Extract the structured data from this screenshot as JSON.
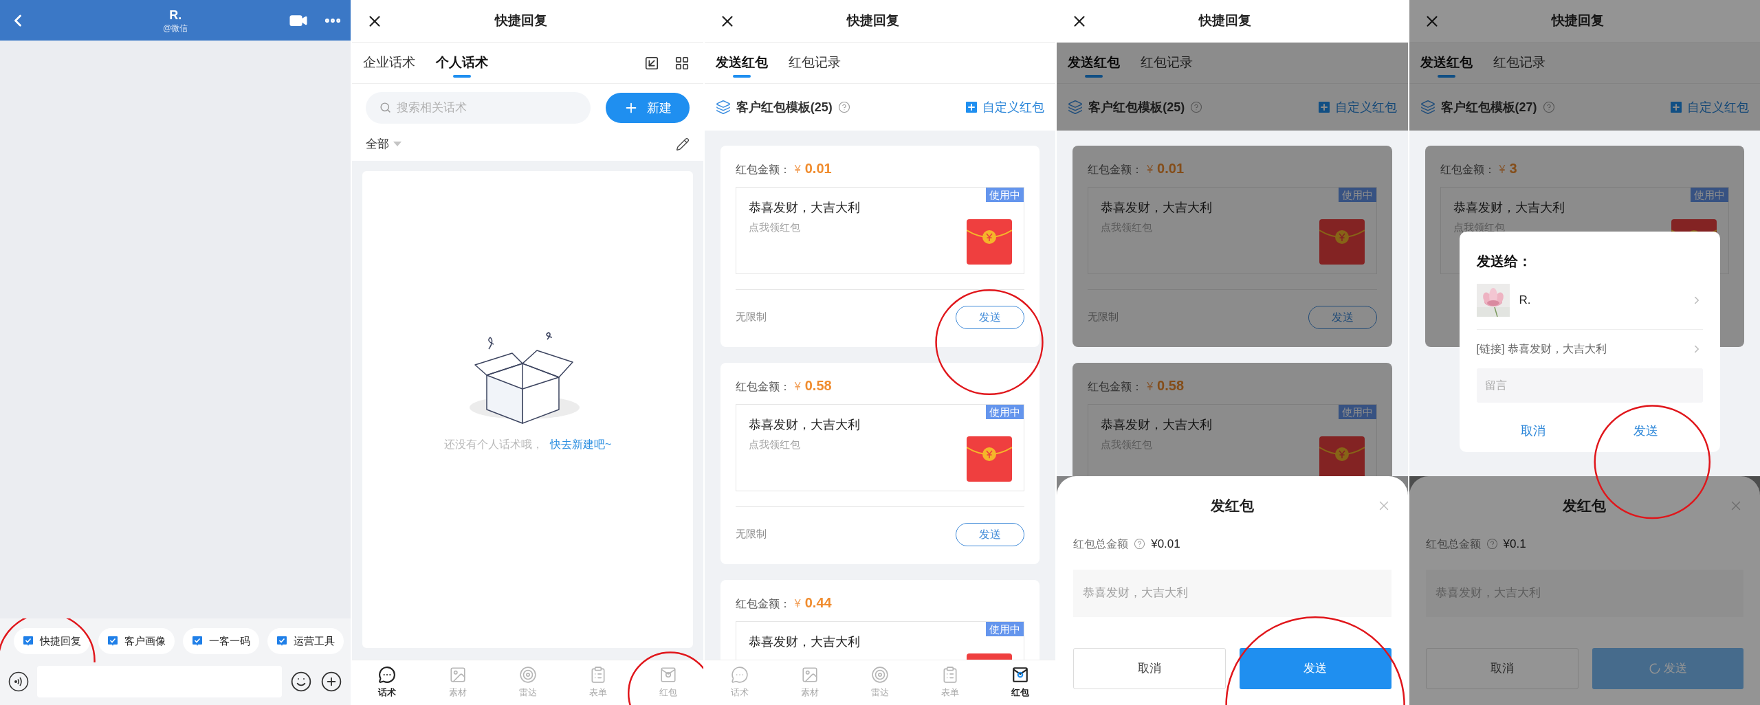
{
  "panels": [
    {
      "kind": "chat",
      "header": {
        "title": "R.",
        "subtitle": "@微信"
      },
      "shortcuts": [
        {
          "label": "快捷回复",
          "circled": true
        },
        {
          "label": "客户画像",
          "circled": false
        },
        {
          "label": "一客一码",
          "circled": false
        },
        {
          "label": "运营工具",
          "circled": false
        }
      ]
    },
    {
      "kind": "scripts",
      "title": "快捷回复",
      "tabs": [
        {
          "label": "企业话术",
          "selected": false
        },
        {
          "label": "个人话术",
          "selected": true
        }
      ],
      "search": {
        "placeholder": "搜索相关话术"
      },
      "new_button": "新建",
      "filter": "全部",
      "empty": {
        "message": "还没有个人话术哦，",
        "link": "快去新建吧~"
      },
      "nav": [
        {
          "label": "话术",
          "selected": true,
          "circled": false
        },
        {
          "label": "素材",
          "selected": false,
          "circled": false
        },
        {
          "label": "雷达",
          "selected": false,
          "circled": false
        },
        {
          "label": "表单",
          "selected": false,
          "circled": false
        },
        {
          "label": "红包",
          "selected": false,
          "circled": true
        }
      ]
    },
    {
      "kind": "red_packet",
      "content_dimmed": false,
      "header_dimmed": false,
      "title": "快捷回复",
      "tabs": [
        {
          "label": "发送红包",
          "selected": true
        },
        {
          "label": "红包记录",
          "selected": false
        }
      ],
      "templates": "客户红包模板(25)",
      "custom": "自定义红包",
      "cards": [
        {
          "amount_label": "红包金额：",
          "currency": "¥",
          "amount": "0.01",
          "badge": "使用中",
          "title": "恭喜发财，大吉大利",
          "subtitle": "点我领红包",
          "limit": "无限制",
          "send": "发送",
          "circled": true
        },
        {
          "amount_label": "红包金额：",
          "currency": "¥",
          "amount": "0.58",
          "badge": "使用中",
          "title": "恭喜发财，大吉大利",
          "subtitle": "点我领红包",
          "limit": "无限制",
          "send": "发送",
          "circled": false
        },
        {
          "amount_label": "红包金额：",
          "currency": "¥",
          "amount": "0.44",
          "badge": "使用中",
          "title": "恭喜发财，大吉大利"
        }
      ],
      "nav": [
        {
          "label": "话术",
          "selected": false,
          "circled": false
        },
        {
          "label": "素材",
          "selected": false,
          "circled": false
        },
        {
          "label": "雷达",
          "selected": false,
          "circled": false
        },
        {
          "label": "表单",
          "selected": false,
          "circled": false
        },
        {
          "label": "红包",
          "selected": true,
          "circled": false
        }
      ]
    },
    {
      "kind": "red_packet",
      "content_dimmed": true,
      "header_dimmed": false,
      "title": "快捷回复",
      "tabs": [
        {
          "label": "发送红包",
          "selected": true
        },
        {
          "label": "红包记录",
          "selected": false
        }
      ],
      "templates": "客户红包模板(25)",
      "custom": "自定义红包",
      "cards": [
        {
          "amount_label": "红包金额：",
          "currency": "¥",
          "amount": "0.01",
          "badge": "使用中",
          "title": "恭喜发财，大吉大利",
          "subtitle": "点我领红包",
          "limit": "无限制",
          "send": "发送",
          "circled": false
        },
        {
          "amount_label": "红包金额：",
          "currency": "¥",
          "amount": "0.58",
          "badge": "使用中",
          "title": "恭喜发财，大吉大利",
          "subtitle": "点我领红包"
        }
      ],
      "sheet": {
        "title": "发红包",
        "total_label": "红包总金额",
        "total": "¥0.01",
        "greeting_placeholder": "恭喜发财，大吉大利",
        "cancel": "取消",
        "send": "发送",
        "loading": false,
        "circled": true
      }
    },
    {
      "kind": "red_packet",
      "content_dimmed": true,
      "header_dimmed": true,
      "title": "快捷回复",
      "tabs": [
        {
          "label": "发送红包",
          "selected": true
        },
        {
          "label": "红包记录",
          "selected": false
        }
      ],
      "templates": "客户红包模板(27)",
      "custom": "自定义红包",
      "cards": [
        {
          "amount_label": "红包金额：",
          "currency": "¥",
          "amount": "3",
          "badge": "使用中",
          "title": "恭喜发财，大吉大利",
          "subtitle": "点我领红包"
        }
      ],
      "sheet": {
        "title": "发红包",
        "total_label": "红包总金额",
        "total": "¥0.1",
        "greeting_placeholder": "恭喜发财，大吉大利",
        "cancel": "取消",
        "send": "发送",
        "loading": true,
        "circled": false
      },
      "dialog": {
        "title": "发送给：",
        "recipient": "R.",
        "link": "[链接] 恭喜发财，大吉大利",
        "message_placeholder": "留言",
        "cancel": "取消",
        "send": "发送",
        "circled": true
      }
    }
  ]
}
